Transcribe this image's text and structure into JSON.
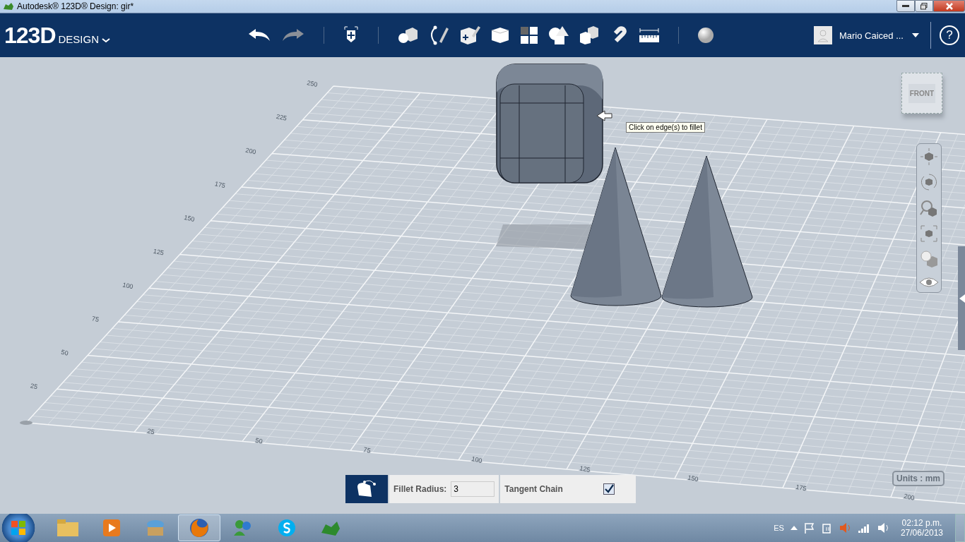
{
  "title_bar": {
    "title": "Autodesk® 123D® Design: gir*"
  },
  "app_bar": {
    "logo": "123D",
    "logo_sub": "DESIGN",
    "user": "Mario Caiced ...",
    "help": "?"
  },
  "viewport": {
    "side_labels": [
      "25",
      "50",
      "75",
      "100",
      "125",
      "150",
      "175",
      "200",
      "225",
      "250"
    ],
    "bottom_labels": [
      "25",
      "50",
      "75",
      "100",
      "125",
      "150",
      "175",
      "200"
    ],
    "tooltip": "Click on edge(s) to fillet",
    "view_cube": "FRONT",
    "units": "Units : mm"
  },
  "fillet_panel": {
    "radius_label": "Fillet Radius:",
    "radius_value": "3",
    "tangent_chain": {
      "label": "Tangent Chain",
      "checked": true
    }
  },
  "taskbar": {
    "language": "ES",
    "time": "02:12 p.m.",
    "date": "27/06/2013"
  }
}
